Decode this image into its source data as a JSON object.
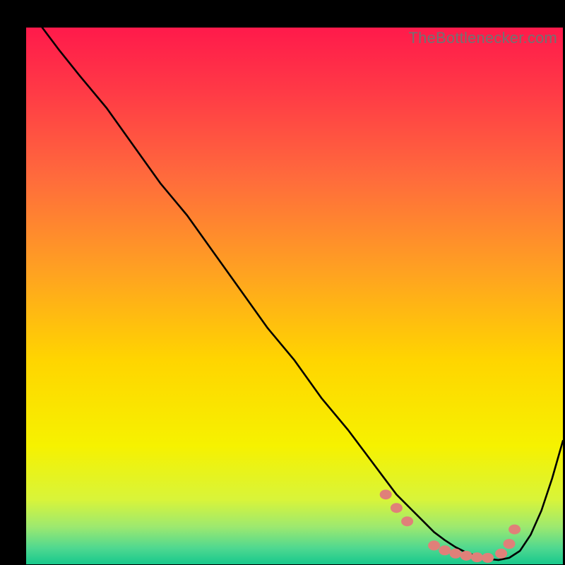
{
  "watermark": "TheBottlenecker.com",
  "chart_data": {
    "type": "line",
    "title": "",
    "xlabel": "",
    "ylabel": "",
    "xlim": [
      0,
      100
    ],
    "ylim": [
      0,
      100
    ],
    "grid": false,
    "background": "rainbow-gradient",
    "gradient_stops": [
      {
        "offset": 0.0,
        "color": "#ff1a4b"
      },
      {
        "offset": 0.12,
        "color": "#ff3a46"
      },
      {
        "offset": 0.28,
        "color": "#ff6b3c"
      },
      {
        "offset": 0.45,
        "color": "#ffa022"
      },
      {
        "offset": 0.62,
        "color": "#ffd500"
      },
      {
        "offset": 0.78,
        "color": "#f6f200"
      },
      {
        "offset": 0.88,
        "color": "#d8f43a"
      },
      {
        "offset": 0.93,
        "color": "#9de96f"
      },
      {
        "offset": 0.97,
        "color": "#4fd890"
      },
      {
        "offset": 1.0,
        "color": "#17c98c"
      }
    ],
    "series": [
      {
        "name": "bottleneck-curve",
        "color": "#000000",
        "x": [
          3,
          6,
          10,
          15,
          20,
          25,
          30,
          35,
          40,
          45,
          50,
          55,
          60,
          63,
          66,
          69,
          72,
          74,
          76,
          78,
          80,
          82,
          84,
          86,
          88,
          90,
          92,
          94,
          96,
          98,
          100
        ],
        "y": [
          100,
          96,
          91,
          85,
          78,
          71,
          65,
          58,
          51,
          44,
          38,
          31,
          25,
          21,
          17,
          13,
          10,
          8,
          6,
          4.5,
          3.2,
          2.2,
          1.5,
          1.0,
          0.8,
          1.2,
          2.5,
          5.5,
          10,
          16,
          23
        ]
      }
    ],
    "markers": {
      "color": "#e08079",
      "points": [
        {
          "x": 67,
          "y": 13
        },
        {
          "x": 69,
          "y": 10.5
        },
        {
          "x": 71,
          "y": 8
        },
        {
          "x": 76,
          "y": 3.5
        },
        {
          "x": 78,
          "y": 2.6
        },
        {
          "x": 80,
          "y": 2.0
        },
        {
          "x": 82,
          "y": 1.6
        },
        {
          "x": 84,
          "y": 1.3
        },
        {
          "x": 86,
          "y": 1.2
        },
        {
          "x": 88.5,
          "y": 2.0
        },
        {
          "x": 90,
          "y": 3.8
        },
        {
          "x": 91,
          "y": 6.5
        }
      ]
    }
  }
}
